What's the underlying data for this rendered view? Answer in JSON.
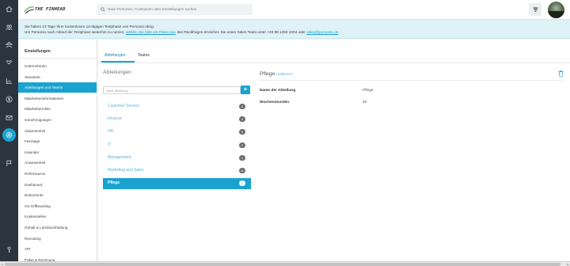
{
  "logo": {
    "text": "THE FINHEAD"
  },
  "search": {
    "placeholder": "Nach Personen, Funktionen oder Einstellungen suchen"
  },
  "banner": {
    "line1": "Sie haben 13 Tage Ihrer kostenlosen 14-tägigen Testphase von Personio übrig.",
    "line2_pre": "Um Personio nach Ablauf der Testphase weiterhin zu nutzen, ",
    "line2_link": "wählen Sie bitte ein Paket aus",
    "line2_mid": ". Bei Rückfragen erreichen Sie unser Sales Team unter ",
    "phone": "+49 89 1250 1004",
    "line2_or": " oder ",
    "email": "sales@personio.de"
  },
  "sidebar": {
    "heading": "Einstellungen",
    "items": [
      "Unternehmen",
      "Standorte",
      "Abteilungen und Teams",
      "Mitarbeiterinformationen",
      "Mitarbeiterrollen",
      "Genehmigungen",
      "Abwesenheit",
      "Feiertage",
      "Kalender",
      "Anwesenheit",
      "Performance",
      "Dashboard",
      "Dokumente",
      "On-/Offboarding",
      "Kostenstellen",
      "Gehalt & Lohnbuchhaltung",
      "Recruiting",
      "API",
      "Paket & Rechnung"
    ],
    "active_index": 2
  },
  "tabs": [
    "Abteilungen",
    "Teams"
  ],
  "departments_panel": {
    "title": "Abteilungen",
    "new_placeholder": "Neue Abteilung...",
    "add_label": "+",
    "items": [
      {
        "name": "Customer Service",
        "count": "0"
      },
      {
        "name": "Finance",
        "count": "4"
      },
      {
        "name": "HR",
        "count": "5"
      },
      {
        "name": "IT",
        "count": "0"
      },
      {
        "name": "Management",
        "count": "1"
      },
      {
        "name": "Marketing and Sales",
        "count": "11"
      },
      {
        "name": "Pflege",
        "count": "1"
      }
    ],
    "active_index": 6
  },
  "detail": {
    "title": "Pflege",
    "edit_label": "(Editieren)",
    "rows": [
      {
        "key": "Name der Abteilung",
        "value": "Pflege"
      },
      {
        "key": "Wochenstunden",
        "value": "40"
      }
    ]
  },
  "colors": {
    "accent": "#1aa3d1",
    "rail": "#2c3440",
    "banner": "#dff2f8"
  },
  "icons": {
    "rail": [
      "home-icon",
      "people-icon",
      "people-group-icon",
      "handshake-icon",
      "chart-icon",
      "money-icon",
      "mail-icon",
      "cloud-icon",
      "settings-icon",
      "flag-icon",
      "key-icon"
    ],
    "search": "search-icon",
    "notification": "notification-icon",
    "trash": "trash-icon"
  }
}
